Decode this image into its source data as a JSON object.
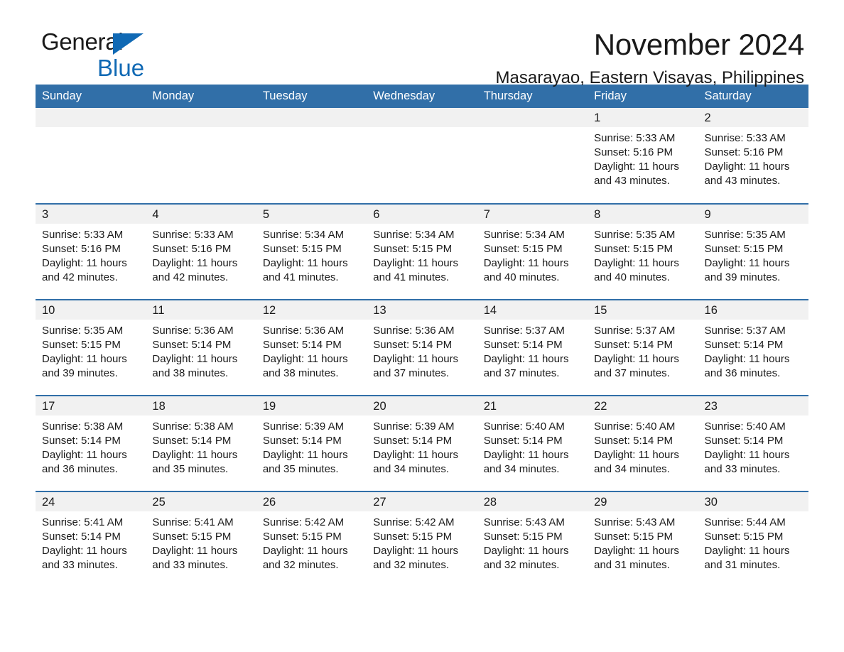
{
  "brand": {
    "name_part1": "General",
    "name_part2": "Blue",
    "flag_icon": "triangle-flag-icon"
  },
  "header": {
    "title": "November 2024",
    "subtitle": "Masarayao, Eastern Visayas, Philippines"
  },
  "calendar": {
    "weekday_headers": [
      "Sunday",
      "Monday",
      "Tuesday",
      "Wednesday",
      "Thursday",
      "Friday",
      "Saturday"
    ],
    "accent_color": "#316fa8",
    "daynum_band_color": "#f1f1f1",
    "weeks": [
      [
        {
          "empty": true
        },
        {
          "empty": true
        },
        {
          "empty": true
        },
        {
          "empty": true
        },
        {
          "empty": true
        },
        {
          "day": "1",
          "sunrise": "Sunrise: 5:33 AM",
          "sunset": "Sunset: 5:16 PM",
          "daylight_line1": "Daylight: 11 hours",
          "daylight_line2": "and 43 minutes."
        },
        {
          "day": "2",
          "sunrise": "Sunrise: 5:33 AM",
          "sunset": "Sunset: 5:16 PM",
          "daylight_line1": "Daylight: 11 hours",
          "daylight_line2": "and 43 minutes."
        }
      ],
      [
        {
          "day": "3",
          "sunrise": "Sunrise: 5:33 AM",
          "sunset": "Sunset: 5:16 PM",
          "daylight_line1": "Daylight: 11 hours",
          "daylight_line2": "and 42 minutes."
        },
        {
          "day": "4",
          "sunrise": "Sunrise: 5:33 AM",
          "sunset": "Sunset: 5:16 PM",
          "daylight_line1": "Daylight: 11 hours",
          "daylight_line2": "and 42 minutes."
        },
        {
          "day": "5",
          "sunrise": "Sunrise: 5:34 AM",
          "sunset": "Sunset: 5:15 PM",
          "daylight_line1": "Daylight: 11 hours",
          "daylight_line2": "and 41 minutes."
        },
        {
          "day": "6",
          "sunrise": "Sunrise: 5:34 AM",
          "sunset": "Sunset: 5:15 PM",
          "daylight_line1": "Daylight: 11 hours",
          "daylight_line2": "and 41 minutes."
        },
        {
          "day": "7",
          "sunrise": "Sunrise: 5:34 AM",
          "sunset": "Sunset: 5:15 PM",
          "daylight_line1": "Daylight: 11 hours",
          "daylight_line2": "and 40 minutes."
        },
        {
          "day": "8",
          "sunrise": "Sunrise: 5:35 AM",
          "sunset": "Sunset: 5:15 PM",
          "daylight_line1": "Daylight: 11 hours",
          "daylight_line2": "and 40 minutes."
        },
        {
          "day": "9",
          "sunrise": "Sunrise: 5:35 AM",
          "sunset": "Sunset: 5:15 PM",
          "daylight_line1": "Daylight: 11 hours",
          "daylight_line2": "and 39 minutes."
        }
      ],
      [
        {
          "day": "10",
          "sunrise": "Sunrise: 5:35 AM",
          "sunset": "Sunset: 5:15 PM",
          "daylight_line1": "Daylight: 11 hours",
          "daylight_line2": "and 39 minutes."
        },
        {
          "day": "11",
          "sunrise": "Sunrise: 5:36 AM",
          "sunset": "Sunset: 5:14 PM",
          "daylight_line1": "Daylight: 11 hours",
          "daylight_line2": "and 38 minutes."
        },
        {
          "day": "12",
          "sunrise": "Sunrise: 5:36 AM",
          "sunset": "Sunset: 5:14 PM",
          "daylight_line1": "Daylight: 11 hours",
          "daylight_line2": "and 38 minutes."
        },
        {
          "day": "13",
          "sunrise": "Sunrise: 5:36 AM",
          "sunset": "Sunset: 5:14 PM",
          "daylight_line1": "Daylight: 11 hours",
          "daylight_line2": "and 37 minutes."
        },
        {
          "day": "14",
          "sunrise": "Sunrise: 5:37 AM",
          "sunset": "Sunset: 5:14 PM",
          "daylight_line1": "Daylight: 11 hours",
          "daylight_line2": "and 37 minutes."
        },
        {
          "day": "15",
          "sunrise": "Sunrise: 5:37 AM",
          "sunset": "Sunset: 5:14 PM",
          "daylight_line1": "Daylight: 11 hours",
          "daylight_line2": "and 37 minutes."
        },
        {
          "day": "16",
          "sunrise": "Sunrise: 5:37 AM",
          "sunset": "Sunset: 5:14 PM",
          "daylight_line1": "Daylight: 11 hours",
          "daylight_line2": "and 36 minutes."
        }
      ],
      [
        {
          "day": "17",
          "sunrise": "Sunrise: 5:38 AM",
          "sunset": "Sunset: 5:14 PM",
          "daylight_line1": "Daylight: 11 hours",
          "daylight_line2": "and 36 minutes."
        },
        {
          "day": "18",
          "sunrise": "Sunrise: 5:38 AM",
          "sunset": "Sunset: 5:14 PM",
          "daylight_line1": "Daylight: 11 hours",
          "daylight_line2": "and 35 minutes."
        },
        {
          "day": "19",
          "sunrise": "Sunrise: 5:39 AM",
          "sunset": "Sunset: 5:14 PM",
          "daylight_line1": "Daylight: 11 hours",
          "daylight_line2": "and 35 minutes."
        },
        {
          "day": "20",
          "sunrise": "Sunrise: 5:39 AM",
          "sunset": "Sunset: 5:14 PM",
          "daylight_line1": "Daylight: 11 hours",
          "daylight_line2": "and 34 minutes."
        },
        {
          "day": "21",
          "sunrise": "Sunrise: 5:40 AM",
          "sunset": "Sunset: 5:14 PM",
          "daylight_line1": "Daylight: 11 hours",
          "daylight_line2": "and 34 minutes."
        },
        {
          "day": "22",
          "sunrise": "Sunrise: 5:40 AM",
          "sunset": "Sunset: 5:14 PM",
          "daylight_line1": "Daylight: 11 hours",
          "daylight_line2": "and 34 minutes."
        },
        {
          "day": "23",
          "sunrise": "Sunrise: 5:40 AM",
          "sunset": "Sunset: 5:14 PM",
          "daylight_line1": "Daylight: 11 hours",
          "daylight_line2": "and 33 minutes."
        }
      ],
      [
        {
          "day": "24",
          "sunrise": "Sunrise: 5:41 AM",
          "sunset": "Sunset: 5:14 PM",
          "daylight_line1": "Daylight: 11 hours",
          "daylight_line2": "and 33 minutes."
        },
        {
          "day": "25",
          "sunrise": "Sunrise: 5:41 AM",
          "sunset": "Sunset: 5:15 PM",
          "daylight_line1": "Daylight: 11 hours",
          "daylight_line2": "and 33 minutes."
        },
        {
          "day": "26",
          "sunrise": "Sunrise: 5:42 AM",
          "sunset": "Sunset: 5:15 PM",
          "daylight_line1": "Daylight: 11 hours",
          "daylight_line2": "and 32 minutes."
        },
        {
          "day": "27",
          "sunrise": "Sunrise: 5:42 AM",
          "sunset": "Sunset: 5:15 PM",
          "daylight_line1": "Daylight: 11 hours",
          "daylight_line2": "and 32 minutes."
        },
        {
          "day": "28",
          "sunrise": "Sunrise: 5:43 AM",
          "sunset": "Sunset: 5:15 PM",
          "daylight_line1": "Daylight: 11 hours",
          "daylight_line2": "and 32 minutes."
        },
        {
          "day": "29",
          "sunrise": "Sunrise: 5:43 AM",
          "sunset": "Sunset: 5:15 PM",
          "daylight_line1": "Daylight: 11 hours",
          "daylight_line2": "and 31 minutes."
        },
        {
          "day": "30",
          "sunrise": "Sunrise: 5:44 AM",
          "sunset": "Sunset: 5:15 PM",
          "daylight_line1": "Daylight: 11 hours",
          "daylight_line2": "and 31 minutes."
        }
      ]
    ]
  }
}
